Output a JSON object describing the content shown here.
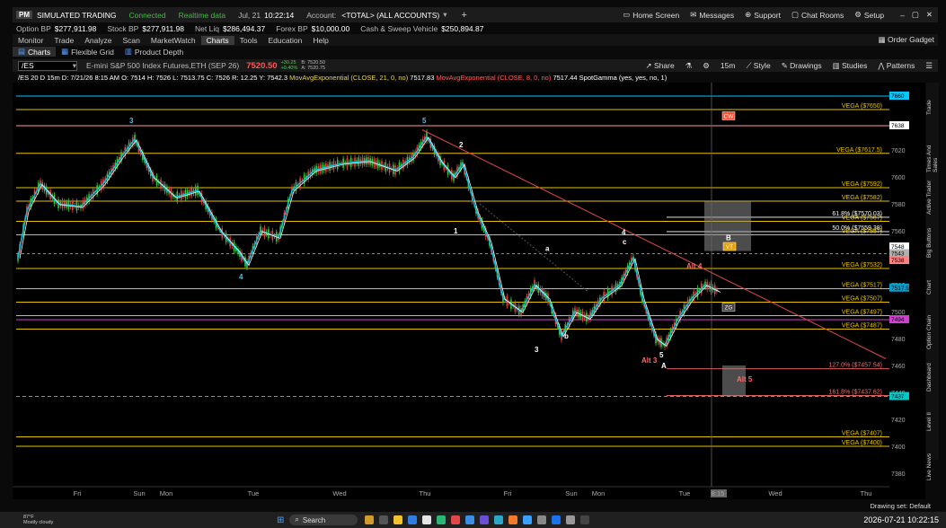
{
  "titlebar": {
    "logo": "PM",
    "mode": "SIMULATED TRADING",
    "connected": "Connected",
    "realtime": "Realtime data",
    "date": "Jul, 21",
    "time": "10:22:14",
    "account_label": "Account:",
    "account": "<TOTAL> (ALL ACCOUNTS)",
    "home_screen": "Home Screen",
    "messages": "Messages",
    "support": "Support",
    "chat_rooms": "Chat Rooms",
    "setup": "Setup"
  },
  "account_bar": {
    "items": [
      {
        "label": "Option BP",
        "value": "$277,911.98"
      },
      {
        "label": "Stock BP",
        "value": "$277,911.98"
      },
      {
        "label": "Net Liq",
        "value": "$286,494.37"
      },
      {
        "label": "Forex BP",
        "value": "$10,000.00"
      },
      {
        "label": "Cash & Sweep Vehicle",
        "value": "$250,894.87"
      }
    ]
  },
  "menu": {
    "items": [
      "Monitor",
      "Trade",
      "Analyze",
      "Scan",
      "MarketWatch",
      "Charts",
      "Tools",
      "Education",
      "Help"
    ],
    "active": "Charts",
    "order_gadget": "Order Gadget"
  },
  "subtabs": {
    "charts": "Charts",
    "flexible_grid": "Flexible Grid",
    "product_depth": "Product Depth"
  },
  "chart_toolbar": {
    "symbol": "/ES",
    "description": "E-mini S&P 500 Index Futures,ETH (SEP 26)",
    "last": "7520.50",
    "change": "+30.25",
    "change_pct": "+0.40%",
    "bid": "B: 7520.50",
    "ask": "A: 7520.75",
    "share": "Share",
    "timeframe": "15m",
    "style": "Style",
    "drawings": "Drawings",
    "studies": "Studies",
    "patterns": "Patterns"
  },
  "chart_info": {
    "ohlc": "/ES 20 D 15m   D: 7/21/26 8:15 AM  O: 7514  H: 7526  L: 7513.75  C: 7526  R: 12.25  Y: 7542.3",
    "ema21": "MovAvgExponential (CLOSE, 21, 0, no)",
    "ema21_val": "7517.83",
    "ema8": "MovAvgExponential (CLOSE, 8, 0, no)",
    "ema8_val": "7517.44",
    "spotgamma": "SpotGamma (yes, yes, no, 1)"
  },
  "chart_data": {
    "type": "line",
    "title": "",
    "xlabel": "",
    "ylabel": "",
    "ylim": [
      7370,
      7670
    ],
    "y_ticks": [
      7380,
      7400,
      7420,
      7440,
      7460,
      7480,
      7500,
      7520,
      7540,
      7560,
      7580,
      7600,
      7620
    ],
    "x_ticks": [
      "Fri",
      "Sun",
      "Mon",
      "Tue",
      "Wed",
      "Thu",
      "Fri",
      "Sun",
      "Mon",
      "Tue",
      "8:15",
      "Wed",
      "Thu"
    ],
    "price_badges": [
      {
        "label": "7660",
        "color": "#00c8ff"
      },
      {
        "label": "7638",
        "color": "#ffffff"
      },
      {
        "label": "7548",
        "color": "#ffffff"
      },
      {
        "label": "7543",
        "color": "#b0b0b0"
      },
      {
        "label": "7538",
        "color": "#ff8080"
      },
      {
        "label": "7517.5",
        "color": "#00a0d0"
      },
      {
        "label": "7494",
        "color": "#d040d0"
      },
      {
        "label": "7437",
        "color": "#00c8c8"
      }
    ],
    "gamma_levels": [
      {
        "label": "VEGA ($7650)",
        "value": 7650
      },
      {
        "label": "VEGA ($7617.5)",
        "value": 7617.5
      },
      {
        "label": "VEGA ($7592)",
        "value": 7592
      },
      {
        "label": "VEGA ($7582)",
        "value": 7582
      },
      {
        "label": "VEGA ($7567)",
        "value": 7567
      },
      {
        "label": "VEGA ($7557)",
        "value": 7557
      },
      {
        "label": "VEGA ($7532)",
        "value": 7532
      },
      {
        "label": "VEGA ($7517)",
        "value": 7517
      },
      {
        "label": "VEGA ($7507)",
        "value": 7507
      },
      {
        "label": "VEGA ($7497)",
        "value": 7497
      },
      {
        "label": "VEGA ($7487)",
        "value": 7487
      },
      {
        "label": "VEGA ($7407)",
        "value": 7407
      },
      {
        "label": "VEGA ($7400)",
        "value": 7400
      }
    ],
    "fib_labels": [
      {
        "label": "61.8%  ($7570.03)",
        "value": 7570.03
      },
      {
        "label": "50.0%  ($7559.38)",
        "value": 7559.38
      },
      {
        "label": "127.0%  ($7457.54)",
        "value": 7457.54
      },
      {
        "label": "161.8%  ($7437.62)",
        "value": 7437.62
      }
    ],
    "wave_labels": [
      "3",
      "5",
      "2",
      "1",
      "4",
      "4",
      "3",
      "a",
      "b",
      "c",
      "B",
      "A",
      "Alt 3",
      "Alt 4",
      "Alt 5",
      "5"
    ],
    "tags": [
      "CW",
      "VT",
      "ZG"
    ]
  },
  "drawing_set": "Drawing set: Default",
  "taskbar": {
    "weather_temp": "87°F",
    "weather_desc": "Mostly cloudy",
    "search": "Search",
    "clock": "2026-07-21  10:22:15"
  },
  "sidebar": [
    "Trade",
    "Times And Sales",
    "Active Trader",
    "Big Buttons",
    "Chart",
    "Option Chain",
    "Dashboard",
    "Level II",
    "Live News"
  ],
  "colors": {
    "background": "#000000",
    "vega_line": "#e6c200",
    "candle_up": "#3ec43e",
    "candle_down": "#e04848",
    "ema_fast": "#f0f0f0",
    "ema_slow": "#00c8e8"
  }
}
